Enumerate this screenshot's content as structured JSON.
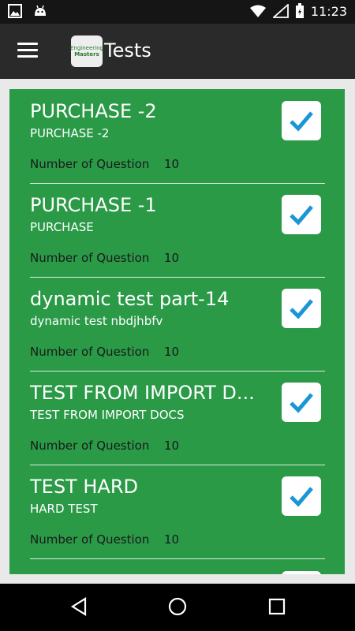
{
  "status_bar": {
    "time": "11:23",
    "icons": [
      "image-icon",
      "android-icon",
      "wifi-icon",
      "signal-icon",
      "battery-icon"
    ]
  },
  "app_bar": {
    "title": "Tests",
    "logo_text_line1": "Engineering",
    "logo_text_line2": "Masters"
  },
  "tests": [
    {
      "name": "PURCHASE -2",
      "subtitle": "PURCHASE -2",
      "question_label": "Number of Question",
      "question_count": "10",
      "checked": true
    },
    {
      "name": "PURCHASE -1",
      "subtitle": "PURCHASE",
      "question_label": "Number of Question",
      "question_count": "10",
      "checked": true
    },
    {
      "name": "dynamic test part-14",
      "subtitle": "dynamic test nbdjhbfv",
      "question_label": "Number of Question",
      "question_count": "10",
      "checked": true
    },
    {
      "name": "TEST FROM IMPORT D...",
      "subtitle": "TEST FROM IMPORT DOCS",
      "question_label": "Number of Question",
      "question_count": "10",
      "checked": true
    },
    {
      "name": "TEST HARD",
      "subtitle": "HARD TEST",
      "question_label": "Number of Question",
      "question_count": "10",
      "checked": true
    }
  ],
  "colors": {
    "list_background": "#2a9a47",
    "app_bar": "#2a2a2a",
    "status_bar": "#151515",
    "check_accent": "#1a96d6"
  },
  "nav_bar": {
    "icons": [
      "back-icon",
      "home-icon",
      "recents-icon"
    ]
  }
}
